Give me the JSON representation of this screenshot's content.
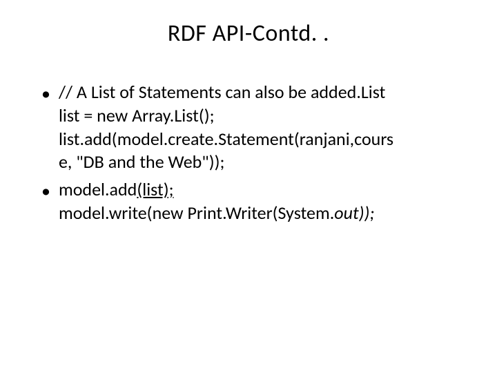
{
  "slide": {
    "title": "RDF API-Contd. .",
    "bullets": [
      {
        "line1": "// A List of Statements can also be added.List",
        "line2": "list = new Array.List();",
        "line3": "list.add(model.create.Statement(ranjani,cours",
        "line4": "e, \"DB and the Web\"));"
      },
      {
        "line1_prefix": "model.add",
        "line1_underlined": "(list);",
        "line2_prefix": "model.write(new Print.Writer(System.",
        "line2_italic": "out));"
      }
    ]
  }
}
